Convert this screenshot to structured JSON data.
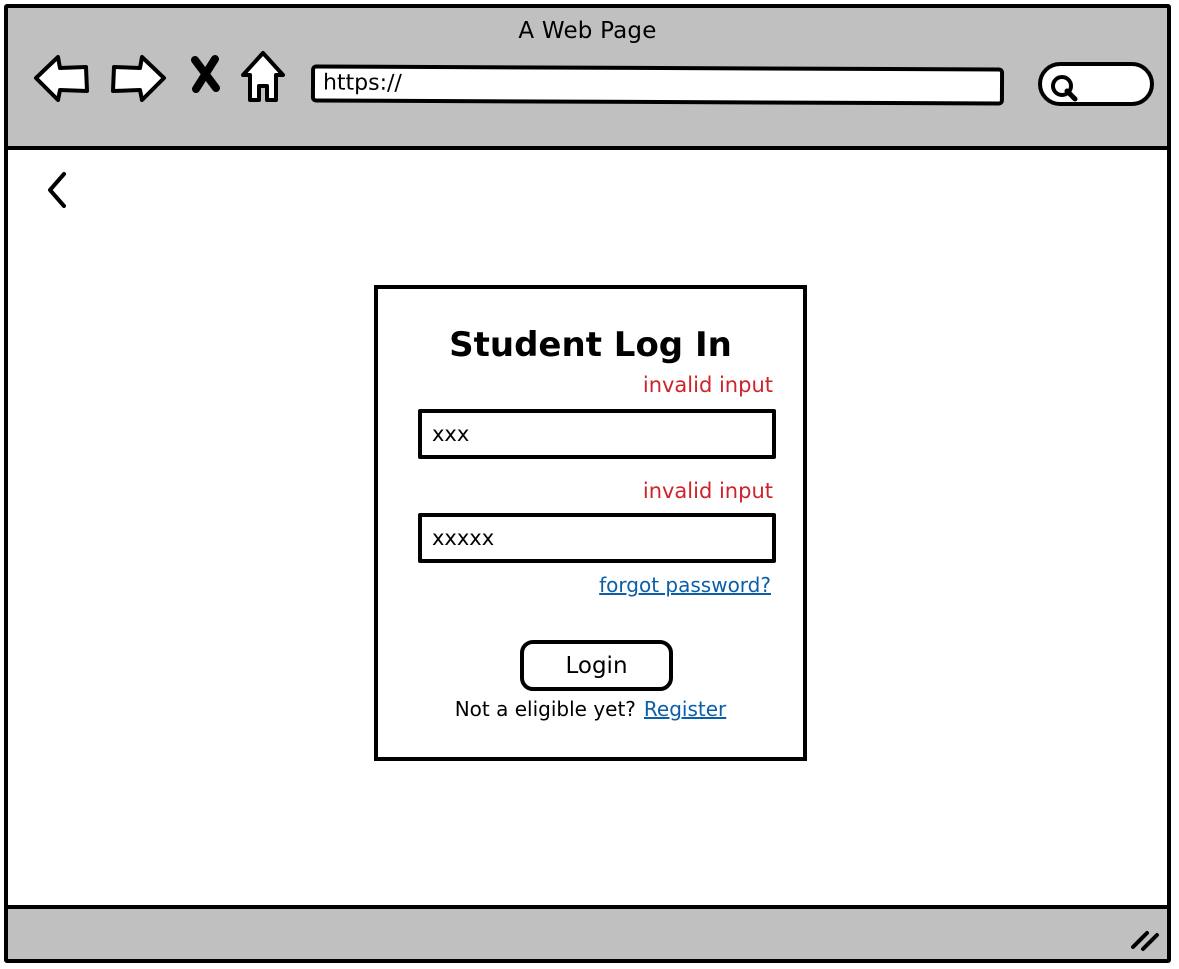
{
  "browser": {
    "title": "A Web Page",
    "url": "https://",
    "icons": [
      "back-arrow-icon",
      "forward-arrow-icon",
      "close-icon",
      "home-icon",
      "search-icon"
    ]
  },
  "page": {
    "back_icon": "chevron-left-icon"
  },
  "login": {
    "title": "Student Log In",
    "username_error": "invalid input",
    "username_value": "xxx",
    "password_error": "invalid input",
    "password_value": "xxxxx",
    "forgot_link": "forgot password?",
    "login_button": "Login",
    "register_prompt": "Not a eligible yet?",
    "register_link": "Register"
  },
  "colors": {
    "chrome": "#c0c0c0",
    "error": "#d0222a",
    "link": "#0a5fa8"
  },
  "status_bar": {
    "resize_icon": "resize-grip-icon"
  }
}
